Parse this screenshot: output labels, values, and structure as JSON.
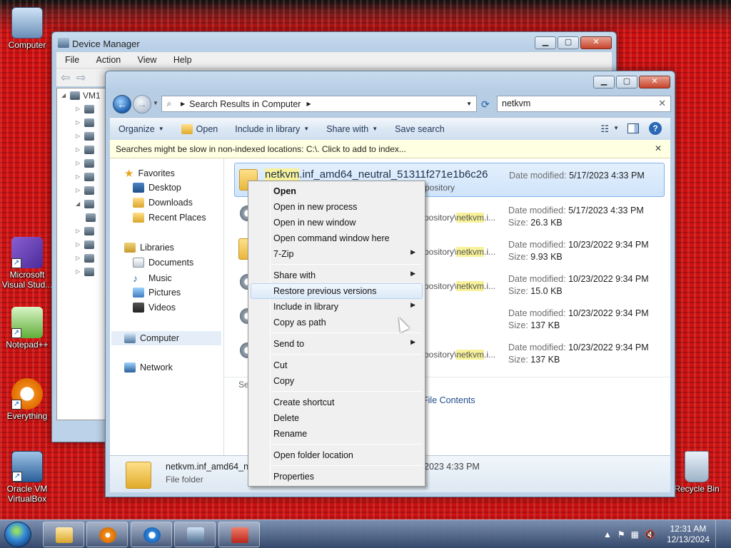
{
  "desktop": {
    "icons": [
      {
        "label": "Computer"
      },
      {
        "label": "Microsoft Visual Stud..."
      },
      {
        "label": "Notepad++"
      },
      {
        "label": "Everything"
      },
      {
        "label": "Oracle VM VirtualBox"
      },
      {
        "label": "Recycle Bin"
      }
    ]
  },
  "device_manager": {
    "title": "Device Manager",
    "menu": [
      "File",
      "Action",
      "View",
      "Help"
    ],
    "tree_root": "VM1"
  },
  "explorer": {
    "breadcrumb": "Search Results in Computer",
    "search_value": "netkvm",
    "commands": {
      "organize": "Organize",
      "open": "Open",
      "include": "Include in library",
      "share": "Share with",
      "save_search": "Save search"
    },
    "infobar": "Searches might be slow in non-indexed locations: C:\\. Click to add to index...",
    "nav": {
      "favorites": "Favorites",
      "desktop": "Desktop",
      "downloads": "Downloads",
      "recent": "Recent Places",
      "libraries": "Libraries",
      "documents": "Documents",
      "music": "Music",
      "pictures": "Pictures",
      "videos": "Videos",
      "computer": "Computer",
      "network": "Network"
    },
    "results": [
      {
        "name_hl": "netkvm",
        "name_rest": ".inf_amd64_neutral_51311f271e1b6c26",
        "path": "pository",
        "meta_label": "Date modified:",
        "date": "5/17/2023 4:33 PM",
        "size_label": "",
        "size": ""
      },
      {
        "name_hl": "",
        "name_rest": "",
        "path_pre": "pository\\",
        "path_hl": "netkvm",
        "path_post": ".i...",
        "meta_label": "Date modified:",
        "date": "5/17/2023 4:33 PM",
        "size_label": "Size:",
        "size": "26.3 KB"
      },
      {
        "name_hl": "",
        "name_rest": "",
        "path_pre": "pository\\",
        "path_hl": "netkvm",
        "path_post": ".i...",
        "meta_label": "Date modified:",
        "date": "10/23/2022 9:34 PM",
        "size_label": "Size:",
        "size": "9.93 KB"
      },
      {
        "name_hl": "",
        "name_rest": "",
        "path_pre": "pository\\",
        "path_hl": "netkvm",
        "path_post": ".i...",
        "meta_label": "Date modified:",
        "date": "10/23/2022 9:34 PM",
        "size_label": "Size:",
        "size": "15.0 KB"
      },
      {
        "name_hl": "",
        "name_rest": "",
        "path_pre": "",
        "path_hl": "",
        "path_post": "",
        "meta_label": "Date modified:",
        "date": "10/23/2022 9:34 PM",
        "size_label": "Size:",
        "size": "137 KB"
      },
      {
        "name_hl": "",
        "name_rest": "",
        "path_pre": "pository\\",
        "path_hl": "netkvm",
        "path_post": ".i...",
        "meta_label": "Date modified:",
        "date": "10/23/2022 9:34 PM",
        "size_label": "Size:",
        "size": "137 KB"
      }
    ],
    "search_again_prefix": "Se",
    "file_contents": "File Contents",
    "details": {
      "name": "netkvm.inf_amd64_n",
      "type": "File folder",
      "date_fragment": "2023 4:33 PM"
    }
  },
  "context_menu": {
    "items": [
      {
        "label": "Open",
        "default": true
      },
      {
        "label": "Open in new process"
      },
      {
        "label": "Open in new window"
      },
      {
        "label": "Open command window here"
      },
      {
        "label": "7-Zip",
        "submenu": true
      },
      {
        "label": "Share with",
        "submenu": true
      },
      {
        "label": "Restore previous versions",
        "hover": true
      },
      {
        "label": "Include in library",
        "submenu": true
      },
      {
        "label": "Copy as path"
      },
      {
        "label": "Send to",
        "submenu": true
      },
      {
        "label": "Cut"
      },
      {
        "label": "Copy"
      },
      {
        "label": "Create shortcut"
      },
      {
        "label": "Delete"
      },
      {
        "label": "Rename"
      },
      {
        "label": "Open folder location"
      },
      {
        "label": "Properties"
      }
    ]
  },
  "taskbar": {
    "time": "12:31 AM",
    "date": "12/13/2024"
  },
  "colors": {
    "desktop_bg": "#d11313",
    "highlight": "#f7f29a",
    "selection": "#cfe4fb",
    "taskbar": "#304a6e"
  }
}
